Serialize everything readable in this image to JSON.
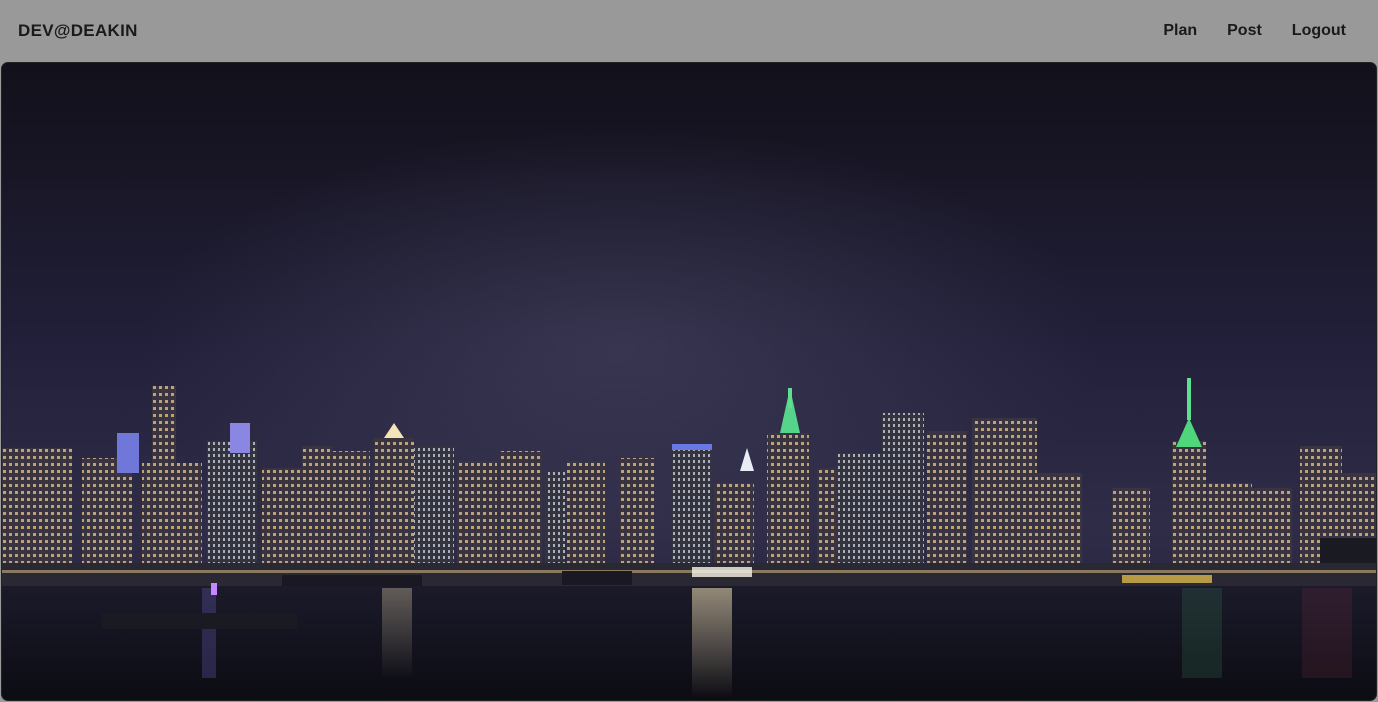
{
  "navbar": {
    "brand": "DEV@DEAKIN",
    "links": [
      {
        "label": "Plan"
      },
      {
        "label": "Post"
      },
      {
        "label": "Logout"
      }
    ]
  },
  "hero": {
    "image": "night-city-skyline",
    "colors": {
      "sky_top": "#15131f",
      "sky_bottom": "#2e2b44",
      "water": "#101019",
      "accent_green": "#4fd67a",
      "window_light": "#f0d9a0"
    }
  }
}
